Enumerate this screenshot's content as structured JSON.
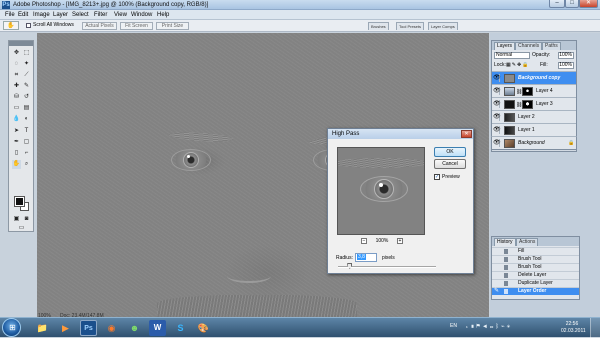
{
  "window": {
    "app_icon": "Ps",
    "title": "Adobe Photoshop - [IMG_8213+.jpg @ 100% (Background copy, RGB/8)]",
    "controls": {
      "minimize": "–",
      "maximize": "□",
      "close": "✕"
    }
  },
  "menu": {
    "items": [
      "File",
      "Edit",
      "Image",
      "Layer",
      "Select",
      "Filter",
      "View",
      "Window",
      "Help"
    ]
  },
  "options_bar": {
    "tool_icon": "hand-icon",
    "scroll_all_windows_label": "Scroll All Windows",
    "buttons": [
      "Actual Pixels",
      "Fit Screen",
      "Print Size"
    ]
  },
  "palette_well": {
    "tabs": [
      "Brushes",
      "Tool Presets",
      "Layer Comps"
    ]
  },
  "layers_panel": {
    "tabs": [
      "Layers",
      "Channels",
      "Paths"
    ],
    "blend_mode": "Normal",
    "opacity_label": "Opacity:",
    "opacity_value": "100%",
    "lock_label": "Lock:",
    "fill_label": "Fill:",
    "fill_value": "100%",
    "layers": [
      {
        "name": "Background copy",
        "selected": true
      },
      {
        "name": "Layer 4",
        "selected": false
      },
      {
        "name": "Layer 3",
        "selected": false
      },
      {
        "name": "Layer 2",
        "selected": false
      },
      {
        "name": "Layer 1",
        "selected": false
      },
      {
        "name": "Background",
        "selected": false
      }
    ]
  },
  "history_panel": {
    "tabs": [
      "History",
      "Actions"
    ],
    "items": [
      {
        "label": "Fill",
        "selected": false
      },
      {
        "label": "Brush Tool",
        "selected": false
      },
      {
        "label": "Brush Tool",
        "selected": false
      },
      {
        "label": "Delete Layer",
        "selected": false
      },
      {
        "label": "Duplicate Layer",
        "selected": false
      },
      {
        "label": "Layer Order",
        "selected": true
      }
    ]
  },
  "dialog": {
    "title": "High Pass",
    "close": "✕",
    "ok_label": "OK",
    "cancel_label": "Cancel",
    "preview_label": "Preview",
    "preview_checked": true,
    "zoom_value": "100%",
    "zoom_out": "−",
    "zoom_in": "+",
    "radius_label": "Radius:",
    "radius_value": "3,8",
    "radius_unit": "pixels",
    "radius_slider_fraction": 0.12
  },
  "status": {
    "zoom": "100%",
    "doc": "Doc: 23,4M/147,8M"
  },
  "taskbar": {
    "apps": [
      "windows-explorer-icon",
      "media-player-icon",
      "photoshop-icon",
      "firefox-icon",
      "messenger-icon",
      "word-icon",
      "skype-icon",
      "paint-icon"
    ],
    "language": "EN",
    "time": "22:56",
    "date": "02.03.2011"
  },
  "colors": {
    "accent_selection": "#3f8ef0",
    "canvas_gray": "#828282",
    "close_red": "#c8442c",
    "taskbar_blue": "#2f506f"
  }
}
